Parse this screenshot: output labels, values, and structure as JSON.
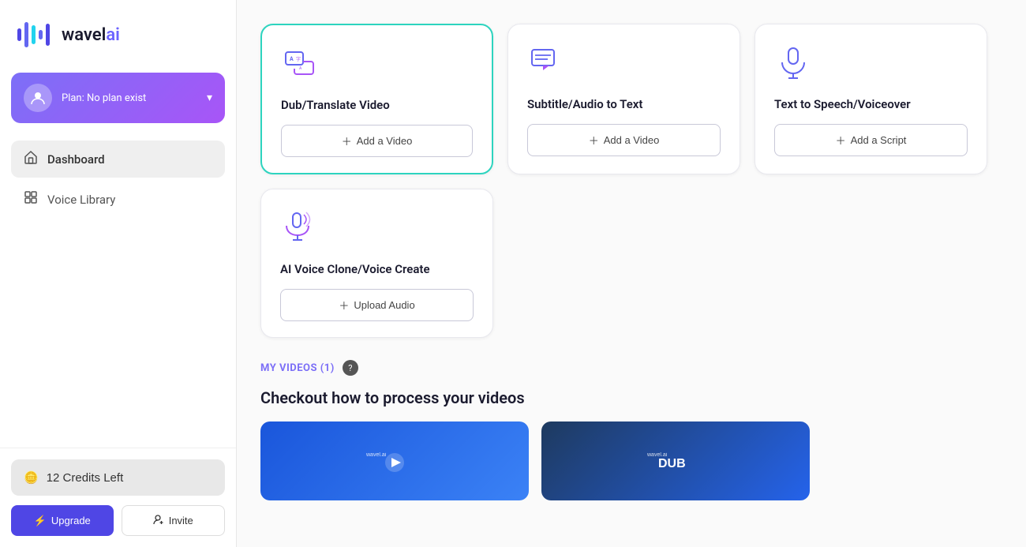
{
  "app": {
    "title": "wavel.ai",
    "title_suffix": "ai"
  },
  "sidebar": {
    "user": {
      "plan_label": "Plan: No plan exist"
    },
    "nav_items": [
      {
        "id": "dashboard",
        "label": "Dashboard",
        "icon": "home",
        "active": true
      },
      {
        "id": "voice-library",
        "label": "Voice Library",
        "icon": "grid",
        "active": false
      }
    ],
    "credits": {
      "label": "12 Credits Left",
      "icon": "coin"
    },
    "upgrade_btn": "Upgrade",
    "invite_btn": "Invite"
  },
  "main": {
    "cards": [
      {
        "id": "dub-translate",
        "title": "Dub/Translate Video",
        "action": "Add a Video",
        "active": true
      },
      {
        "id": "subtitle-audio",
        "title": "Subtitle/Audio to Text",
        "action": "Add a Video",
        "active": false
      },
      {
        "id": "text-to-speech",
        "title": "Text to Speech/Voiceover",
        "action": "Add a Script",
        "active": false
      }
    ],
    "cards_row2": [
      {
        "id": "ai-voice-clone",
        "title": "AI Voice Clone/Voice Create",
        "action": "Upload Audio",
        "active": false
      }
    ],
    "my_videos": {
      "title": "MY VIDEOS (1)",
      "checkout_text": "Checkout how to process your videos"
    },
    "video_thumbs": [
      {
        "id": "thumb1",
        "brand": "wavel.ai",
        "style": "blue"
      },
      {
        "id": "thumb2",
        "brand": "DUB",
        "style": "dark"
      }
    ]
  }
}
